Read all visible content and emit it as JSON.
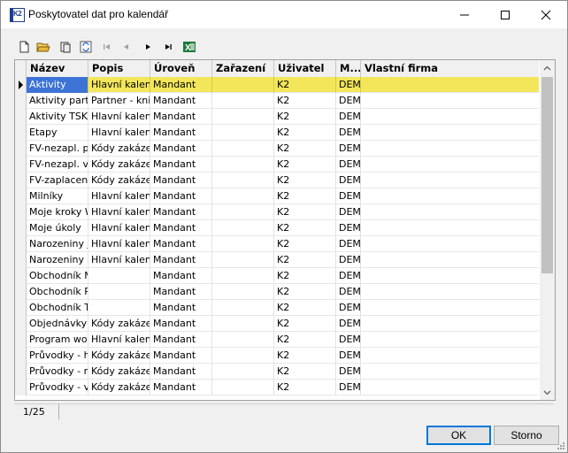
{
  "window": {
    "title": "Poskytovatel dat pro kalendář",
    "icon_text": "K2"
  },
  "toolbar": {
    "buttons": [
      "new-icon",
      "open-icon",
      "copy-icon",
      "refresh-icon",
      "first-record-icon",
      "previous-record-icon",
      "next-record-icon",
      "last-record-icon",
      "excel-export-icon"
    ]
  },
  "grid": {
    "columns": [
      "Název",
      "Popis",
      "Úroveň",
      "Zařazení",
      "Uživatel",
      "M...",
      "Vlastní firma"
    ],
    "rows": [
      [
        "Aktivity",
        "Hlavní kalendář",
        "Mandant",
        "",
        "K2",
        "DEMO",
        ""
      ],
      [
        "Aktivity partner",
        "Partner - kniha",
        "Mandant",
        "",
        "K2",
        "DEMO",
        ""
      ],
      [
        "Aktivity TSK",
        "Hlavní kalendář",
        "Mandant",
        "",
        "K2",
        "DEMO",
        ""
      ],
      [
        "Etapy",
        "Hlavní kalendář",
        "Mandant",
        "",
        "K2",
        "DEMO",
        ""
      ],
      [
        "FV-nezapl. po",
        "Kódy zakázek",
        "Mandant",
        "",
        "K2",
        "DEMO",
        ""
      ],
      [
        "FV-nezapl. ve",
        "Kódy zakázek",
        "Mandant",
        "",
        "K2",
        "DEMO",
        ""
      ],
      [
        "FV-zaplaceno",
        "Kódy zakázek",
        "Mandant",
        "",
        "K2",
        "DEMO",
        ""
      ],
      [
        "Milníky",
        "Hlavní kalendář",
        "Mandant",
        "",
        "K2",
        "DEMO",
        ""
      ],
      [
        "Moje kroky WF",
        "Hlavní kalendář",
        "Mandant",
        "",
        "K2",
        "DEMO",
        ""
      ],
      [
        "Moje úkoly",
        "Hlavní kalendář",
        "Mandant",
        "",
        "K2",
        "DEMO",
        ""
      ],
      [
        "Narozeniny jen",
        "Hlavní kalendář",
        "Mandant",
        "",
        "K2",
        "DEMO",
        ""
      ],
      [
        "Narozeniny za",
        "Hlavní kalendář",
        "Mandant",
        "",
        "K2",
        "DEMO",
        ""
      ],
      [
        "Obchodník Mo",
        "",
        "Mandant",
        "",
        "K2",
        "DEMO",
        ""
      ],
      [
        "Obchodník Pol",
        "",
        "Mandant",
        "",
        "K2",
        "DEMO",
        ""
      ],
      [
        "Obchodník Tor",
        "",
        "Mandant",
        "",
        "K2",
        "DEMO",
        ""
      ],
      [
        "Objednávky p",
        "Kódy zakázek",
        "Mandant",
        "",
        "K2",
        "DEMO",
        ""
      ],
      [
        "Program works",
        "Hlavní kalendář",
        "Mandant",
        "",
        "K2",
        "DEMO",
        ""
      ],
      [
        "Průvodky - ho",
        "Kódy zakázek",
        "Mandant",
        "",
        "K2",
        "DEMO",
        ""
      ],
      [
        "Průvodky - ne",
        "Kódy zakázek",
        "Mandant",
        "",
        "K2",
        "DEMO",
        ""
      ],
      [
        "Průvodky - ve",
        "Kódy zakázek",
        "Mandant",
        "",
        "K2",
        "DEMO",
        ""
      ]
    ]
  },
  "status": {
    "record": "1/25"
  },
  "buttons": {
    "ok": "OK",
    "cancel": "Storno"
  },
  "colors": {
    "selected_row": "#f3e65a",
    "selected_cell": "#3d73d6",
    "ok_border": "#0078d7"
  }
}
